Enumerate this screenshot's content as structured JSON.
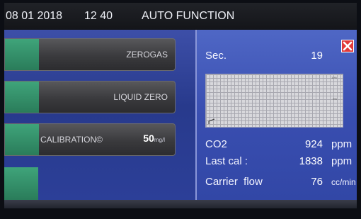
{
  "header": {
    "date": "08 01 2018",
    "time": "12 40",
    "title": "AUTO FUNCTION"
  },
  "menu": {
    "zerogas_label": "ZEROGAS",
    "liquid_zero_label": "LIQUID ZERO",
    "calibration_label": "CALIBRATION©",
    "calibration_value": "50",
    "calibration_unit": "mg/l"
  },
  "panel": {
    "sec_label": "Sec.",
    "sec_value": "19",
    "graph_tick_top": "10%",
    "graph_tick_mid": "5%",
    "rows": [
      {
        "label": "CO2",
        "value": "924",
        "unit": "ppm"
      },
      {
        "label": "Last cal :",
        "value": "1838",
        "unit": "ppm"
      },
      {
        "label": "Carrier  flow",
        "value": "76",
        "unit": "cc/min"
      }
    ]
  },
  "colors": {
    "accent_green": "#3fa47a",
    "panel_blue": "#394eb0",
    "close_red": "#e23a3a"
  }
}
